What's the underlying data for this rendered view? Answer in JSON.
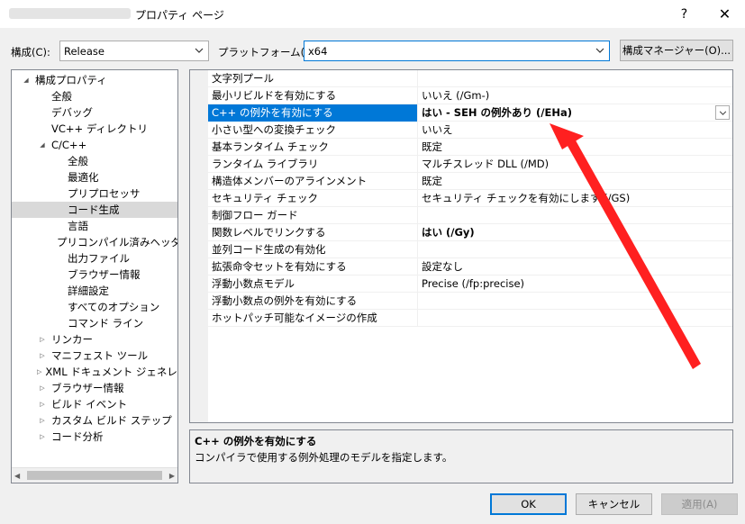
{
  "window": {
    "title": "プロパティ ページ",
    "help": "?",
    "close": "✕"
  },
  "toolbar": {
    "config_label": "構成(C):",
    "config_value": "Release",
    "platform_label": "プラットフォーム(P):",
    "platform_value": "x64",
    "manager_button": "構成マネージャー(O)..."
  },
  "tree": [
    {
      "label": "構成プロパティ",
      "indent": 0,
      "expander": "expanded"
    },
    {
      "label": "全般",
      "indent": 1,
      "expander": "none"
    },
    {
      "label": "デバッグ",
      "indent": 1,
      "expander": "none"
    },
    {
      "label": "VC++ ディレクトリ",
      "indent": 1,
      "expander": "none"
    },
    {
      "label": "C/C++",
      "indent": 1,
      "expander": "expanded"
    },
    {
      "label": "全般",
      "indent": 2,
      "expander": "none"
    },
    {
      "label": "最適化",
      "indent": 2,
      "expander": "none"
    },
    {
      "label": "プリプロセッサ",
      "indent": 2,
      "expander": "none"
    },
    {
      "label": "コード生成",
      "indent": 2,
      "expander": "none",
      "selected": true
    },
    {
      "label": "言語",
      "indent": 2,
      "expander": "none"
    },
    {
      "label": "プリコンパイル済みヘッダー",
      "indent": 2,
      "expander": "none"
    },
    {
      "label": "出力ファイル",
      "indent": 2,
      "expander": "none"
    },
    {
      "label": "ブラウザー情報",
      "indent": 2,
      "expander": "none"
    },
    {
      "label": "詳細設定",
      "indent": 2,
      "expander": "none"
    },
    {
      "label": "すべてのオプション",
      "indent": 2,
      "expander": "none"
    },
    {
      "label": "コマンド ライン",
      "indent": 2,
      "expander": "none"
    },
    {
      "label": "リンカー",
      "indent": 1,
      "expander": "collapsed"
    },
    {
      "label": "マニフェスト ツール",
      "indent": 1,
      "expander": "collapsed"
    },
    {
      "label": "XML ドキュメント ジェネレーター",
      "indent": 1,
      "expander": "collapsed"
    },
    {
      "label": "ブラウザー情報",
      "indent": 1,
      "expander": "collapsed"
    },
    {
      "label": "ビルド イベント",
      "indent": 1,
      "expander": "collapsed"
    },
    {
      "label": "カスタム ビルド ステップ",
      "indent": 1,
      "expander": "collapsed"
    },
    {
      "label": "コード分析",
      "indent": 1,
      "expander": "collapsed"
    }
  ],
  "properties": [
    {
      "name": "文字列プール",
      "value": ""
    },
    {
      "name": "最小リビルドを有効にする",
      "value": "いいえ (/Gm-)"
    },
    {
      "name": "C++ の例外を有効にする",
      "value": "はい - SEH の例外あり (/EHa)",
      "selected": true,
      "bold": true
    },
    {
      "name": "小さい型への変換チェック",
      "value": "いいえ"
    },
    {
      "name": "基本ランタイム チェック",
      "value": "既定"
    },
    {
      "name": "ランタイム ライブラリ",
      "value": "マルチスレッド DLL (/MD)"
    },
    {
      "name": "構造体メンバーのアラインメント",
      "value": "既定"
    },
    {
      "name": "セキュリティ チェック",
      "value": "セキュリティ チェックを有効にします (/GS)"
    },
    {
      "name": "制御フロー ガード",
      "value": ""
    },
    {
      "name": "関数レベルでリンクする",
      "value": "はい (/Gy)",
      "bold": true
    },
    {
      "name": "並列コード生成の有効化",
      "value": ""
    },
    {
      "name": "拡張命令セットを有効にする",
      "value": "設定なし"
    },
    {
      "name": "浮動小数点モデル",
      "value": "Precise (/fp:precise)"
    },
    {
      "name": "浮動小数点の例外を有効にする",
      "value": ""
    },
    {
      "name": "ホットパッチ可能なイメージの作成",
      "value": ""
    }
  ],
  "description": {
    "title": "C++ の例外を有効にする",
    "text": "コンパイラで使用する例外処理のモデルを指定します。"
  },
  "buttons": {
    "ok": "OK",
    "cancel": "キャンセル",
    "apply": "適用(A)"
  },
  "icons": {
    "dropdown": "chevron-down-icon",
    "expanded": "▲",
    "collapsed": "▷"
  },
  "colors": {
    "accent": "#0078d7",
    "annotation_arrow": "#ff2020"
  }
}
